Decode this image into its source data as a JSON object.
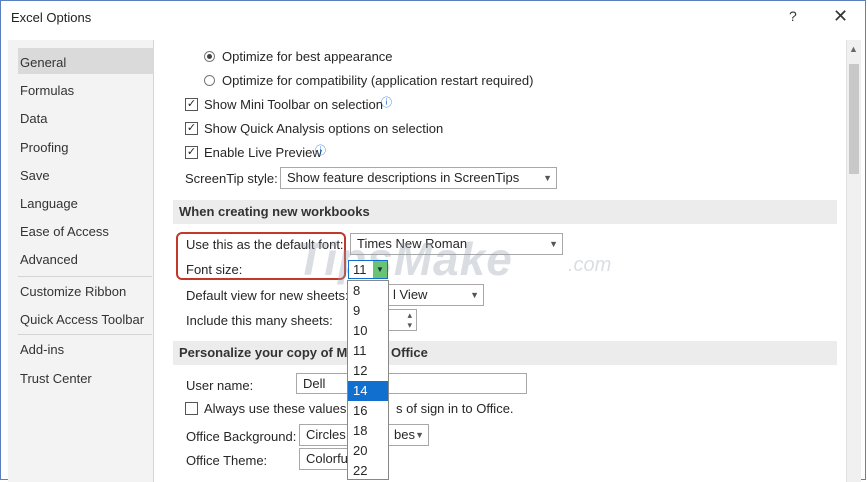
{
  "window": {
    "title": "Excel Options",
    "help": "?",
    "close": "✕"
  },
  "sidebar": {
    "items": [
      {
        "label": "General"
      },
      {
        "label": "Formulas"
      },
      {
        "label": "Data"
      },
      {
        "label": "Proofing"
      },
      {
        "label": "Save"
      },
      {
        "label": "Language"
      },
      {
        "label": "Ease of Access"
      },
      {
        "label": "Advanced"
      },
      {
        "label": "Customize Ribbon"
      },
      {
        "label": "Quick Access Toolbar"
      },
      {
        "label": "Add-ins"
      },
      {
        "label": "Trust Center"
      }
    ],
    "selected": "General"
  },
  "ui_options": {
    "radio_best": {
      "label": "Optimize for best appearance",
      "checked": true
    },
    "radio_compat": {
      "label": "Optimize for compatibility (application restart required)",
      "checked": false
    },
    "mini_toolbar": {
      "label": "Show Mini Toolbar on selection",
      "checked": true
    },
    "quick_analysis": {
      "label": "Show Quick Analysis options on selection",
      "checked": true
    },
    "live_preview": {
      "label": "Enable Live Preview",
      "checked": true
    },
    "screentip_label": "ScreenTip style:",
    "screentip_value": "Show feature descriptions in ScreenTips"
  },
  "new_workbooks": {
    "header": "When creating new workbooks",
    "default_font_label": "Use this as the default font:",
    "default_font_value": "Times New Roman",
    "font_size_label": "Font size:",
    "font_size_value": "11",
    "default_view_label": "Default view for new sheets:",
    "default_view_value": "l View",
    "sheets_label": "Include this many sheets:",
    "font_size_options": [
      "8",
      "9",
      "10",
      "11",
      "12",
      "14",
      "16",
      "18",
      "20",
      "22"
    ],
    "font_size_highlighted": "14"
  },
  "personalize": {
    "header": "Personalize your copy of Micr",
    "header_tail": "Office",
    "user_name_label": "User name:",
    "user_name_value": "Dell",
    "always_use_label_a": "Always use these values re",
    "always_use_label_b": "s of sign in to Office.",
    "always_use_checked": false,
    "background_label": "Office Background:",
    "background_value_a": "Circles a",
    "background_value_b": "bes",
    "theme_label": "Office Theme:",
    "theme_value": "Colorful"
  },
  "watermark": {
    "text": "TipsMake",
    "suffix": ".com"
  }
}
